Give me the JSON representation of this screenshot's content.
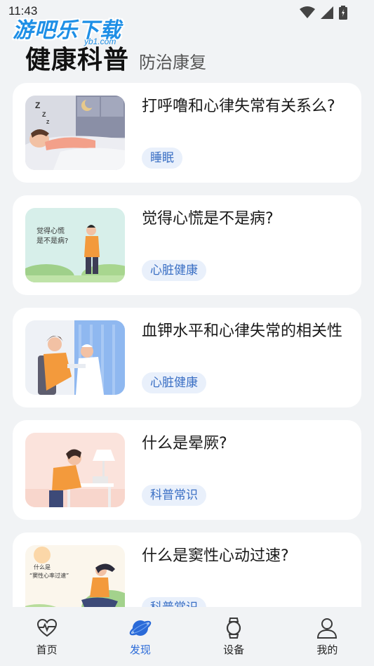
{
  "status_bar": {
    "time": "11:43"
  },
  "watermark": {
    "text": "游吧乐下载",
    "sub": "yb1.com"
  },
  "header": {
    "title": "健康科普",
    "subtitle": "防治康复"
  },
  "articles": [
    {
      "title": "打呼噜和心律失常有关系么?",
      "tag": "睡眠",
      "image": "sleeping-person"
    },
    {
      "title": "觉得心慌是不是病?",
      "tag": "心脏健康",
      "image": "palpitation-person",
      "image_text": [
        "觉得心慌",
        "是不是病?"
      ]
    },
    {
      "title": "血钾水平和心律失常的相关性",
      "tag": "心脏健康",
      "image": "blood-test"
    },
    {
      "title": "什么是晕厥?",
      "tag": "科普常识",
      "image": "fainting-person"
    },
    {
      "title": "什么是窦性心动过速?",
      "tag": "科普常识",
      "image": "meditating-person",
      "image_text": [
        "什么是",
        "“窦性心率过速”"
      ]
    }
  ],
  "tabbar": {
    "items": [
      {
        "label": "首页",
        "icon": "heart-pulse-icon",
        "active": false
      },
      {
        "label": "发现",
        "icon": "planet-icon",
        "active": true
      },
      {
        "label": "设备",
        "icon": "watch-icon",
        "active": false
      },
      {
        "label": "我的",
        "icon": "person-icon",
        "active": false
      }
    ]
  },
  "colors": {
    "accent": "#2a6ad8",
    "tag_bg": "#e9f0fb",
    "tag_text": "#3a6fc4",
    "background": "#f1f3f5"
  }
}
